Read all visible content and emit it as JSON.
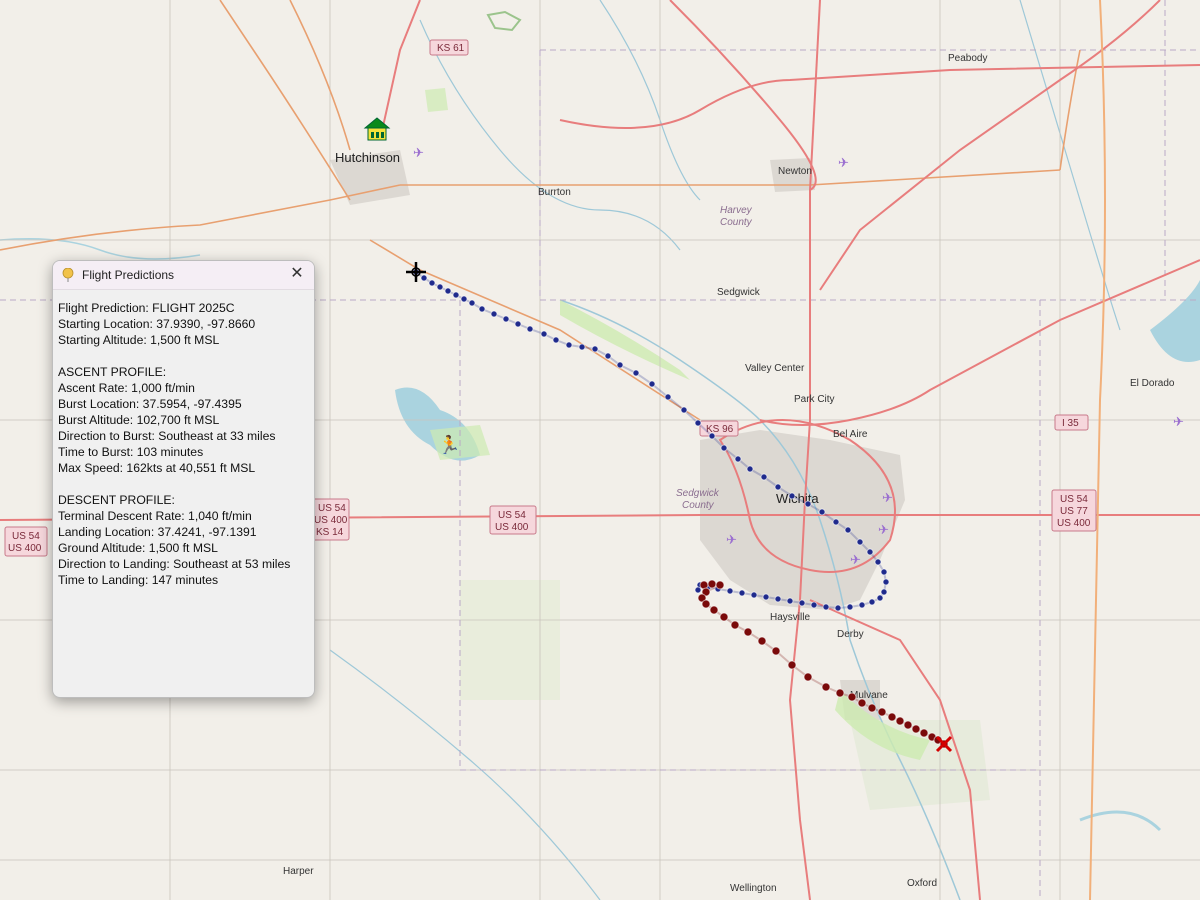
{
  "window": {
    "title": "Flight Predictions",
    "close_label": "✕"
  },
  "flight": {
    "line1": "Flight Prediction: FLIGHT 2025C",
    "line2": "Starting Location: 37.9390, -97.8660",
    "line3": "Starting Altitude: 1,500 ft MSL"
  },
  "ascent": {
    "heading": "ASCENT PROFILE:",
    "rate": "Ascent Rate: 1,000 ft/min",
    "burst_location": "Burst Location: 37.5954, -97.4395",
    "burst_altitude": "Burst Altitude: 102,700 ft MSL",
    "direction": "Direction to Burst: Southeast at 33 miles",
    "time": "Time to Burst: 103 minutes",
    "max_speed": "Max Speed: 162kts at 40,551 ft MSL"
  },
  "descent": {
    "heading": "DESCENT PROFILE:",
    "rate": "Terminal Descent Rate: 1,040 ft/min",
    "landing_location": "Landing Location: 37.4241, -97.1391",
    "ground_altitude": "Ground Altitude: 1,500 ft MSL",
    "direction": "Direction to Landing: Southeast at 53 miles",
    "time": "Time to Landing: 147 minutes"
  },
  "map": {
    "places": {
      "hutchinson": "Hutchinson",
      "burrton": "Burrton",
      "newton": "Newton",
      "peabody": "Peabody",
      "sedgwick": "Sedgwick",
      "valley_center": "Valley Center",
      "park_city": "Park City",
      "bel_aire": "Bel Aire",
      "wichita": "Wichita",
      "el_dorado": "El Dorado",
      "haysville": "Haysville",
      "derby": "Derby",
      "mulvane": "Mulvane",
      "harper": "Harper",
      "wellington": "Wellington",
      "oxford": "Oxford"
    },
    "counties": {
      "harvey_1": "Harvey",
      "harvey_2": "County",
      "sedgwick_1": "Sedgwick",
      "sedgwick_2": "County"
    },
    "shields": {
      "ks61": "KS 61",
      "ks96": "KS 96",
      "i35": "I 35",
      "us54a_1": "US 54",
      "us54a_2": "US 400",
      "us54b_1": "US 54",
      "us54b_2": "US 400",
      "us54b_3": "KS 14",
      "us54c_1": "US 54",
      "us54c_2": "US 400",
      "us54d_1": "US 54",
      "us54d_2": "US 77",
      "us54d_3": "US 400"
    },
    "colors": {
      "ascent_track": "#1f2a8c",
      "descent_track": "#7a0a0a",
      "primary_road": "#e87d7d",
      "secondary_road": "#e8a070",
      "water": "#aad3df"
    }
  }
}
